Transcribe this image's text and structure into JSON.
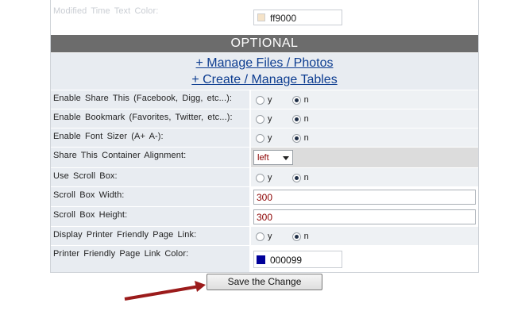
{
  "modified_time": {
    "label": "Modified Time Text Color:",
    "value": "ff9000",
    "swatch_color": "#f5e3c8"
  },
  "optional": {
    "header": "OPTIONAL",
    "links": [
      "+ Manage Files / Photos",
      "+ Create / Manage Tables"
    ]
  },
  "radio_labels": {
    "yes": "y",
    "no": "n"
  },
  "rows": {
    "share_this": {
      "label": "Enable Share This (Facebook, Digg, etc...):",
      "selected": "n"
    },
    "bookmark": {
      "label": "Enable Bookmark (Favorites, Twitter, etc...):",
      "selected": "n"
    },
    "font_sizer": {
      "label": "Enable Font Sizer (A+ A-):",
      "selected": "n"
    },
    "alignment": {
      "label": "Share This Container Alignment:",
      "value": "left"
    },
    "scroll_box": {
      "label": "Use Scroll Box:",
      "selected": "n"
    },
    "scroll_width": {
      "label": "Scroll Box Width:",
      "value": "300"
    },
    "scroll_height": {
      "label": "Scroll Box Height:",
      "value": "300"
    },
    "printer_link": {
      "label": "Display Printer Friendly Page Link:",
      "selected": "n"
    },
    "printer_color": {
      "label": "Printer Friendly Page Link Color:",
      "value": "000099",
      "swatch_color": "#000099"
    }
  },
  "save_button": {
    "label": "Save the Change"
  },
  "colors": {
    "header_bg": "#6c6c6c",
    "link": "#0c3c90",
    "arrow": "#9b1b1b"
  }
}
